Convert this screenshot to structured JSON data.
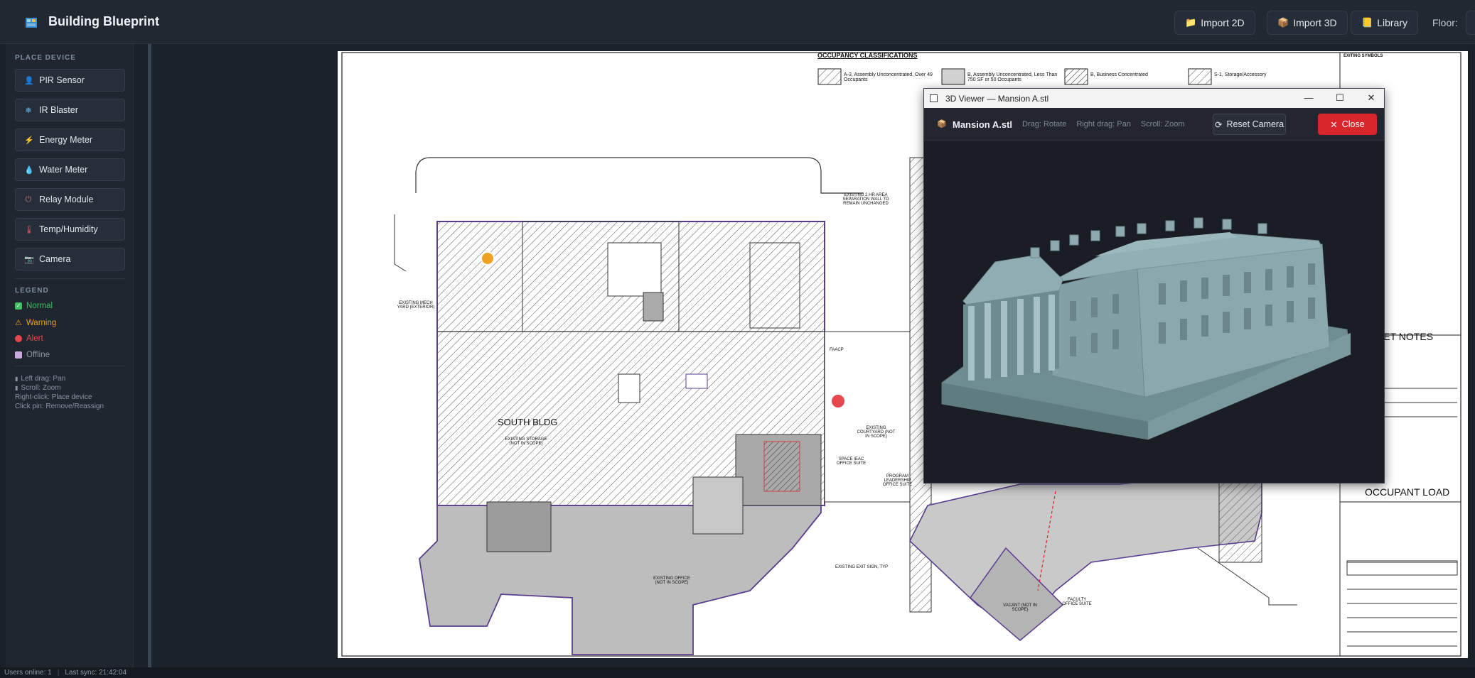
{
  "app": {
    "title": "Building Blueprint"
  },
  "header": {
    "import_2d": "Import 2D",
    "import_3d": "Import 3D",
    "library": "Library",
    "floor_label": "Floor:"
  },
  "sidebar": {
    "place_device_heading": "PLACE DEVICE",
    "devices": [
      {
        "label": "PIR Sensor",
        "icon": "person-icon"
      },
      {
        "label": "IR Blaster",
        "icon": "snowflake-icon"
      },
      {
        "label": "Energy Meter",
        "icon": "lightning-icon"
      },
      {
        "label": "Water Meter",
        "icon": "droplet-icon"
      },
      {
        "label": "Relay Module",
        "icon": "switch-icon"
      },
      {
        "label": "Temp/Humidity",
        "icon": "thermometer-icon"
      },
      {
        "label": "Camera",
        "icon": "camera-icon"
      }
    ],
    "legend_heading": "LEGEND",
    "legend": [
      {
        "label": "Normal",
        "color": "#3fbf5f"
      },
      {
        "label": "Warning",
        "color": "#f0a020"
      },
      {
        "label": "Alert",
        "color": "#e5484d"
      },
      {
        "label": "Offline",
        "color": "#c9a8e0"
      }
    ],
    "help": [
      "Left drag: Pan",
      "Scroll: Zoom",
      "Right-click: Place device",
      "Click pin: Remove/Reassign"
    ]
  },
  "blueprint": {
    "occupancy_title": "OCCUPANCY CLASSIFICATIONS",
    "occ_a3": "A-3, Assembly Unconcentrated, Over 49 Occupants",
    "occ_b_assembly": "B, Assembly Unconcentrated, Less Than 750 SF or 50 Occupants",
    "occ_b_business": "B, Business Concentrated",
    "occ_s1": "S-1, Storage/Accessory",
    "exiting_symbols": "EXITING SYMBOLS",
    "south_bldg": "SOUTH BLDG",
    "existing_storage": "EXISTING STORAGE (NOT IN SCOPE)",
    "existing_mech_yard": "EXISTING MECH YARD (EXTERIOR)",
    "existing_office": "EXISTING OFFICE (NOT IN SCOPE)",
    "space_ieac": "SPACE IEAC OFFICE SUITE",
    "program_leadership": "PROGRAM LEADERSHIP OFFICE SUITE",
    "existing_courtyard": "EXISTING COURTYARD (NOT IN SCOPE)",
    "vacant": "VACANT (NOT IN SCOPE)",
    "faculty_office": "FACULTY OFFICE SUITE",
    "exit_sign": "EXISTING EXIT SIGN, TYP",
    "two_hr": "EXISTING 2 HR AREA SEPARATION WALL TO REMAIN UNCHANGED",
    "sheet_notes": "AL SHEET NOTES",
    "occupant_load": "OCCUPANT LOAD",
    "faacp": "FAACP"
  },
  "viewer": {
    "window_title": "3D Viewer — Mansion A.stl",
    "file_name": "Mansion A.stl",
    "hints": [
      "Drag: Rotate",
      "Right drag: Pan",
      "Scroll: Zoom"
    ],
    "reset_label": "Reset Camera",
    "close_label": "Close",
    "model_color": "#7f9ca1"
  },
  "status": {
    "users": "Users online: 1",
    "sync": "Last sync: 21:42:04"
  }
}
